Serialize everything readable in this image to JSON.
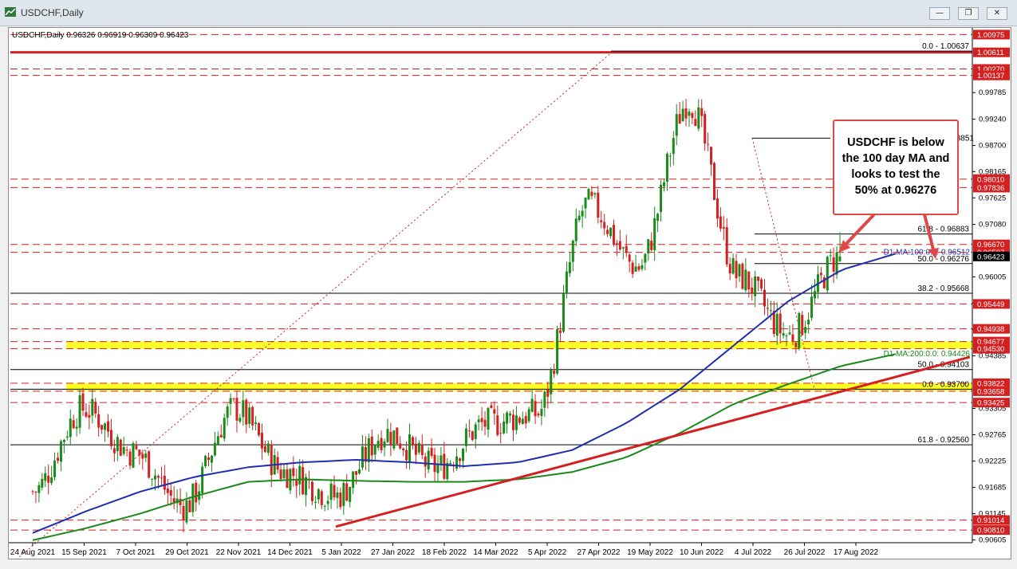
{
  "window": {
    "title": "USDCHF,Daily",
    "icon": "chart-window-icon",
    "controls": [
      "minimize-icon",
      "restore-icon",
      "close-icon"
    ]
  },
  "chart_data": {
    "type": "candlestick",
    "symbol_header": "USDCHF,Daily",
    "ohlc_header": "0.96326 0.96919 0.96309 0.96423",
    "ylim": [
      0.9055,
      1.0108
    ],
    "y_ticks": [
      "0.99785",
      "0.99240",
      "0.98700",
      "0.98165",
      "0.97625",
      "0.97080",
      "0.96005",
      "0.95465",
      "0.94925",
      "0.94385",
      "0.93305",
      "0.92765",
      "0.92225",
      "0.91685",
      "0.91145",
      "0.90605"
    ],
    "x_labels": [
      "24 Aug 2021",
      "15 Sep 2021",
      "7 Oct 2021",
      "29 Oct 2021",
      "22 Nov 2021",
      "14 Dec 2021",
      "5 Jan 2022",
      "27 Jan 2022",
      "18 Feb 2022",
      "14 Mar 2022",
      "5 Apr 2022",
      "27 Apr 2022",
      "19 May 2022",
      "10 Jun 2022",
      "4 Jul 2022",
      "26 Jul 2022",
      "17 Aug 2022"
    ],
    "h_lines": [
      {
        "price": 1.00975,
        "label": "1.00975",
        "style": "dashed"
      },
      {
        "price": 1.00611,
        "label": "1.00611",
        "style": "solid-thick"
      },
      {
        "price": 1.0027,
        "label": "1.00270",
        "style": "dashed"
      },
      {
        "price": 1.00137,
        "label": "1.00137",
        "style": "dashed"
      },
      {
        "price": 0.9801,
        "label": "0.98010",
        "style": "dashed"
      },
      {
        "price": 0.97836,
        "label": "0.97836",
        "style": "dashed"
      },
      {
        "price": 0.9667,
        "label": "0.96670",
        "style": "dashed"
      },
      {
        "price": 0.96507,
        "label": "0.96507",
        "style": "dashed"
      },
      {
        "price": 0.95449,
        "label": "0.95449",
        "style": "dashed"
      },
      {
        "price": 0.94938,
        "label": "0.94938",
        "style": "dashed"
      },
      {
        "price": 0.94677,
        "label": "0.94677",
        "style": "dashed"
      },
      {
        "price": 0.9453,
        "label": "0.94530",
        "style": "dashed"
      },
      {
        "price": 0.93822,
        "label": "0.93822",
        "style": "dashed"
      },
      {
        "price": 0.93658,
        "label": "0.93658",
        "style": "dashed"
      },
      {
        "price": 0.93425,
        "label": "0.93425",
        "style": "dashed"
      },
      {
        "price": 0.91014,
        "label": "0.91014",
        "style": "dashed"
      },
      {
        "price": 0.9081,
        "label": "0.90810",
        "style": "dashed"
      }
    ],
    "yellow_zones": [
      [
        0.9453,
        0.94677
      ],
      [
        0.93658,
        0.93822
      ]
    ],
    "fib_upper": [
      {
        "price": 1.00637,
        "label": "0.0 - 1.00637"
      },
      {
        "price": 0.96883,
        "label": "61.8 - 0.96883"
      },
      {
        "price": 0.96276,
        "label": "50.0 - 0.96276"
      },
      {
        "price": 0.95668,
        "label": "38.2 - 0.95668"
      }
    ],
    "fib_lower": [
      {
        "price": 0.94103,
        "label": "50.0 - 0.94103"
      },
      {
        "price": 0.937,
        "label": "0.0 - 0.93700"
      },
      {
        "price": 0.9256,
        "label": "61.8 - 0.92560"
      }
    ],
    "swing_high_label": "0.98851",
    "ma100_label": "D1 MA:100:0.0: 0.96512",
    "ma200_label": "D1 MA:200:0.0: 0.94426",
    "current_price": "0.96423",
    "anchors": [
      {
        "date": "24 Aug 2021",
        "ma100": 0.9075,
        "ma200": 0.906
      },
      {
        "date": "15 Sep 2021",
        "ma100": 0.912,
        "ma200": 0.9085
      },
      {
        "date": "7 Oct 2021",
        "ma100": 0.916,
        "ma200": 0.9115
      },
      {
        "date": "29 Oct 2021",
        "ma100": 0.919,
        "ma200": 0.915
      },
      {
        "date": "22 Nov 2021",
        "ma100": 0.921,
        "ma200": 0.918
      },
      {
        "date": "14 Dec 2021",
        "ma100": 0.922,
        "ma200": 0.9185
      },
      {
        "date": "5 Jan 2022",
        "ma100": 0.9225,
        "ma200": 0.9182
      },
      {
        "date": "27 Jan 2022",
        "ma100": 0.922,
        "ma200": 0.918
      },
      {
        "date": "18 Feb 2022",
        "ma100": 0.9212,
        "ma200": 0.918
      },
      {
        "date": "14 Mar 2022",
        "ma100": 0.922,
        "ma200": 0.9185
      },
      {
        "date": "5 Apr 2022",
        "ma100": 0.9245,
        "ma200": 0.92
      },
      {
        "date": "27 Apr 2022",
        "ma100": 0.93,
        "ma200": 0.923
      },
      {
        "date": "19 May 2022",
        "ma100": 0.937,
        "ma200": 0.928
      },
      {
        "date": "10 Jun 2022",
        "ma100": 0.946,
        "ma200": 0.934
      },
      {
        "date": "4 Jul 2022",
        "ma100": 0.955,
        "ma200": 0.938
      },
      {
        "date": "26 Jul 2022",
        "ma100": 0.9615,
        "ma200": 0.9418
      },
      {
        "date": "17 Aug 2022",
        "ma100": 0.9648,
        "ma200": 0.9442
      }
    ],
    "price_path": [
      {
        "date": "24 Aug 2021",
        "close": 0.916
      },
      {
        "date": "15 Sep 2021",
        "close": 0.933
      },
      {
        "date": "7 Oct 2021",
        "close": 0.924
      },
      {
        "date": "29 Oct 2021",
        "close": 0.913
      },
      {
        "date": "22 Nov 2021",
        "close": 0.933
      },
      {
        "date": "14 Dec 2021",
        "close": 0.92
      },
      {
        "date": "5 Jan 2022",
        "close": 0.915
      },
      {
        "date": "27 Jan 2022",
        "close": 0.928
      },
      {
        "date": "18 Feb 2022",
        "close": 0.921
      },
      {
        "date": "14 Mar 2022",
        "close": 0.93
      },
      {
        "date": "5 Apr 2022",
        "close": 0.932
      },
      {
        "date": "27 Apr 2022",
        "close": 0.975
      },
      {
        "date": "19 May 2022",
        "close": 0.962
      },
      {
        "date": "10 Jun 2022",
        "close": 0.996
      },
      {
        "date": "4 Jul 2022",
        "close": 0.96
      },
      {
        "date": "26 Jul 2022",
        "close": 0.948
      },
      {
        "date": "17 Aug 2022",
        "close": 0.9642
      }
    ],
    "annotation": {
      "lines": [
        "USDCHF is below",
        "the 100 day MA and",
        "looks to test the",
        "50% at 0.96276"
      ]
    },
    "series": [
      {
        "name": "D1 MA:100",
        "color": "#1f2fb0"
      },
      {
        "name": "D1 MA:200",
        "color": "#1a8a1a"
      }
    ],
    "colors": {
      "up": "#1a8a1a",
      "down": "#d42020",
      "trendline": "#d42020",
      "zone": "#ffff00"
    }
  }
}
